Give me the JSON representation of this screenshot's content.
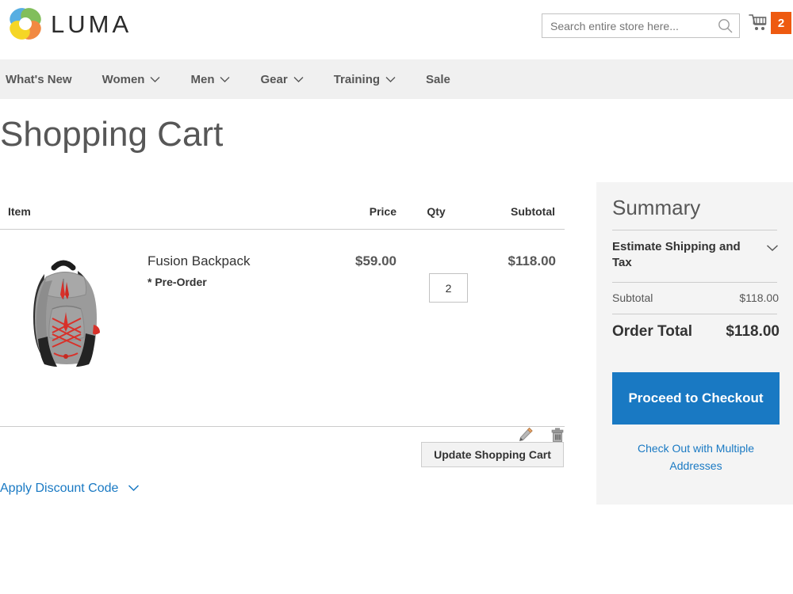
{
  "header": {
    "brand": "LUMA",
    "logo_icon": "luma-rings-logo",
    "logo_colors": [
      "#3aa0dd",
      "#6cb33f",
      "#ef7522",
      "#f4d000"
    ],
    "search": {
      "placeholder": "Search entire store here...",
      "value": "",
      "icon": "search-icon"
    },
    "cart": {
      "icon": "shopping-cart-icon",
      "count": "2",
      "badge_color": "#ee5a10"
    }
  },
  "nav": {
    "background": "#f0f0f0",
    "items": [
      {
        "label": "What's New",
        "has_dropdown": false
      },
      {
        "label": "Women",
        "has_dropdown": true
      },
      {
        "label": "Men",
        "has_dropdown": true
      },
      {
        "label": "Gear",
        "has_dropdown": true
      },
      {
        "label": "Training",
        "has_dropdown": true
      },
      {
        "label": "Sale",
        "has_dropdown": false
      }
    ]
  },
  "page": {
    "title": "Shopping Cart"
  },
  "cart_table": {
    "columns": {
      "item": "Item",
      "price": "Price",
      "qty": "Qty",
      "subtotal": "Subtotal"
    },
    "rows": [
      {
        "name": "Fusion Backpack",
        "note": "* Pre-Order",
        "image_alt": "gray-backpack-image",
        "price": "$59.00",
        "qty": "2",
        "subtotal": "$118.00",
        "edit_icon": "pencil-icon",
        "delete_icon": "trash-icon"
      }
    ],
    "update_button": "Update Shopping Cart",
    "discount_link": "Apply Discount Code",
    "discount_chevron": "chevron-down-icon"
  },
  "summary": {
    "title": "Summary",
    "estimate_label": "Estimate Shipping and Tax",
    "estimate_chevron": "chevron-down-icon",
    "subtotal_label": "Subtotal",
    "subtotal_value": "$118.00",
    "order_total_label": "Order Total",
    "order_total_value": "$118.00",
    "checkout_button": "Proceed to Checkout",
    "multi_address_link": "Check Out with Multiple Addresses",
    "accent_color": "#1979c3",
    "background": "#f4f4f4"
  }
}
